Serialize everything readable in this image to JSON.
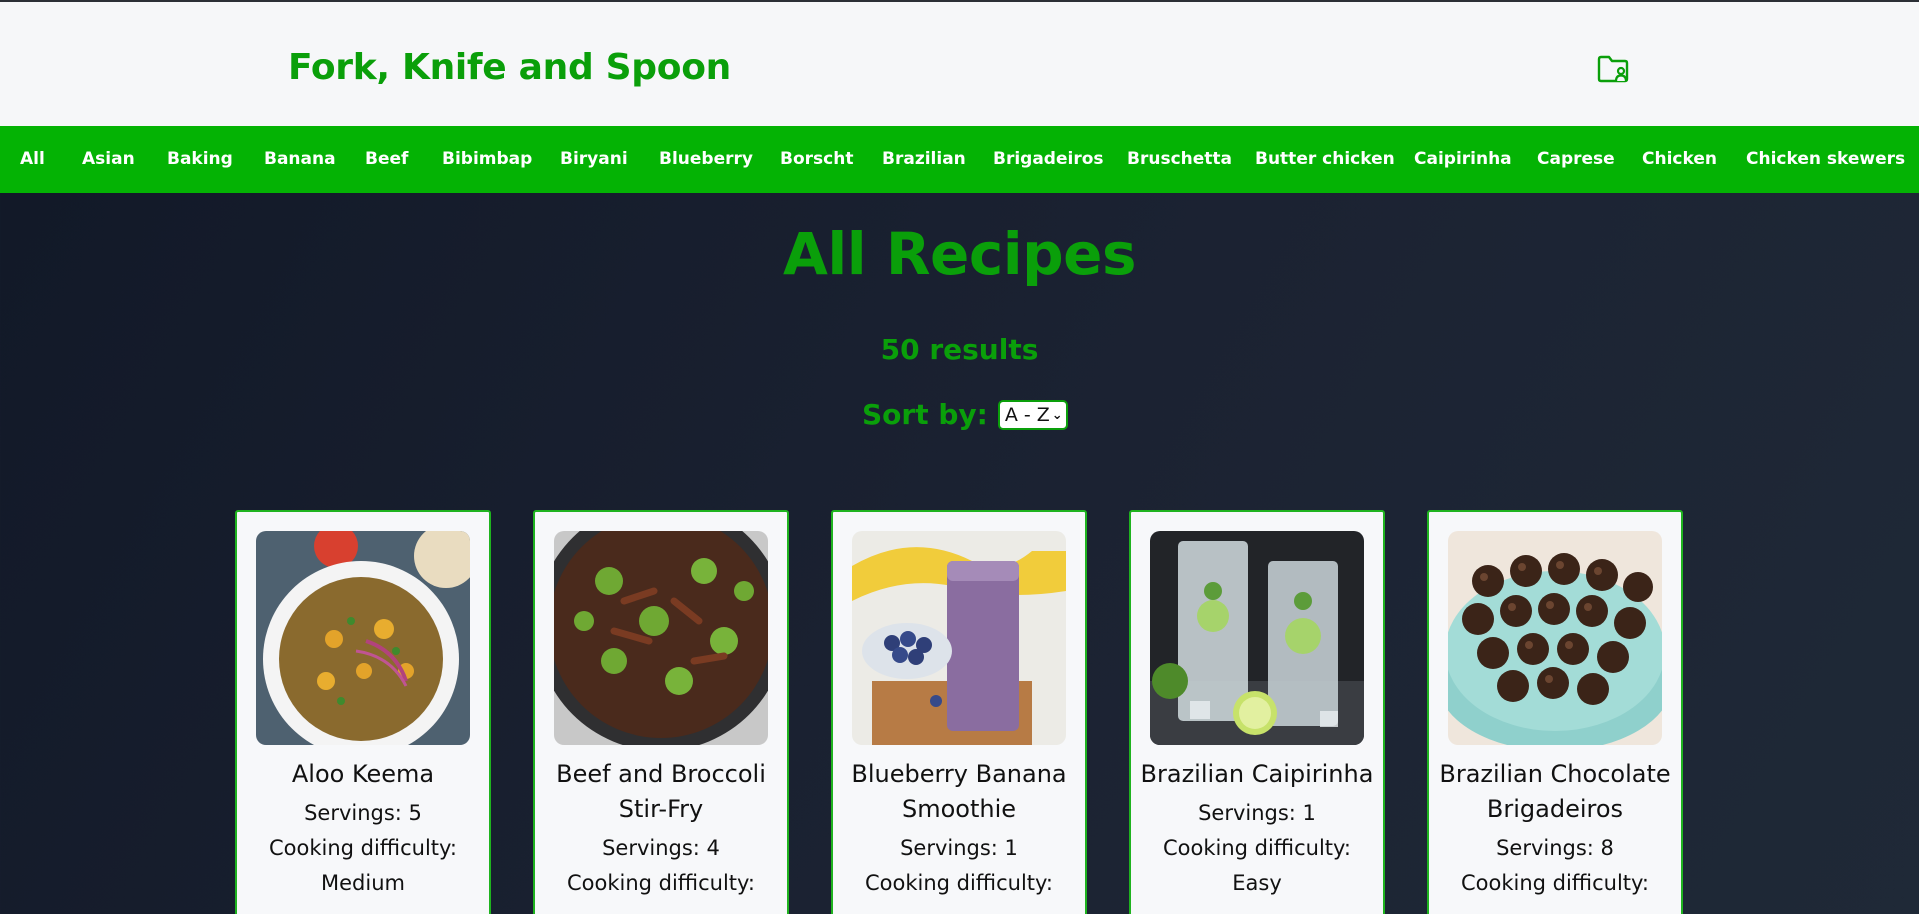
{
  "header": {
    "brand": "Fork, Knife and Spoon",
    "user_icon": "folder-user-icon"
  },
  "colors": {
    "brand_green": "#0a9f0a",
    "nav_green": "#04b304",
    "background": "#1b2232"
  },
  "nav": {
    "items": [
      "All",
      "Asian",
      "Baking",
      "Banana",
      "Beef",
      "Bibimbap",
      "Biryani",
      "Blueberry",
      "Borscht",
      "Brazilian",
      "Brigadeiros",
      "Bruschetta",
      "Butter chicken",
      "Caipirinha",
      "Caprese",
      "Chicken",
      "Chicken skewers"
    ]
  },
  "main": {
    "title": "All Recipes",
    "results": "50 results",
    "sort_label": "Sort by:",
    "sort_value": "A - Z"
  },
  "recipes": [
    {
      "title": "Aloo Keema",
      "servings": "Servings: 5",
      "difficulty_label": "Cooking difficulty:",
      "difficulty": "Medium"
    },
    {
      "title": "Beef and Broccoli Stir-Fry",
      "servings": "Servings: 4",
      "difficulty_label": "Cooking difficulty:",
      "difficulty": ""
    },
    {
      "title": "Blueberry Banana Smoothie",
      "servings": "Servings: 1",
      "difficulty_label": "Cooking difficulty:",
      "difficulty": ""
    },
    {
      "title": "Brazilian Caipirinha",
      "servings": "Servings: 1",
      "difficulty_label": "Cooking difficulty:",
      "difficulty": "Easy"
    },
    {
      "title": "Brazilian Chocolate Brigadeiros",
      "servings": "Servings: 8",
      "difficulty_label": "Cooking difficulty:",
      "difficulty": ""
    }
  ]
}
